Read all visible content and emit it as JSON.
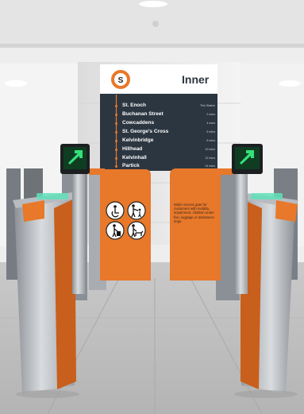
{
  "sign": {
    "logo_letter": "S",
    "direction": "Inner",
    "stops": [
      {
        "name": "St. Enoch",
        "time": "This Station"
      },
      {
        "name": "Buchanan Street",
        "time": "2 mins"
      },
      {
        "name": "Cowcaddens",
        "time": "4 mins"
      },
      {
        "name": "St. George's Cross",
        "time": "6 mins"
      },
      {
        "name": "Kelvinbridge",
        "time": "8 mins"
      },
      {
        "name": "Hillhead",
        "time": "10 mins"
      },
      {
        "name": "Kelvinhall",
        "time": "12 mins"
      },
      {
        "name": "Partick",
        "time": "14 mins"
      }
    ]
  },
  "gate_notice": "Wider access gate for customers with mobility impairment, children under five, luggage or assistance dogs.",
  "pictograms": [
    "wheelchair-user",
    "adult-with-child",
    "person-with-luggage",
    "person-with-assistance-dog"
  ],
  "colors": {
    "subway_orange": "#e8782a",
    "sign_panel": "#2c3640",
    "go_arrow": "#35e07a"
  },
  "icons": [
    "subway-logo",
    "green-arrow-indicator-left",
    "green-arrow-indicator-right"
  ]
}
